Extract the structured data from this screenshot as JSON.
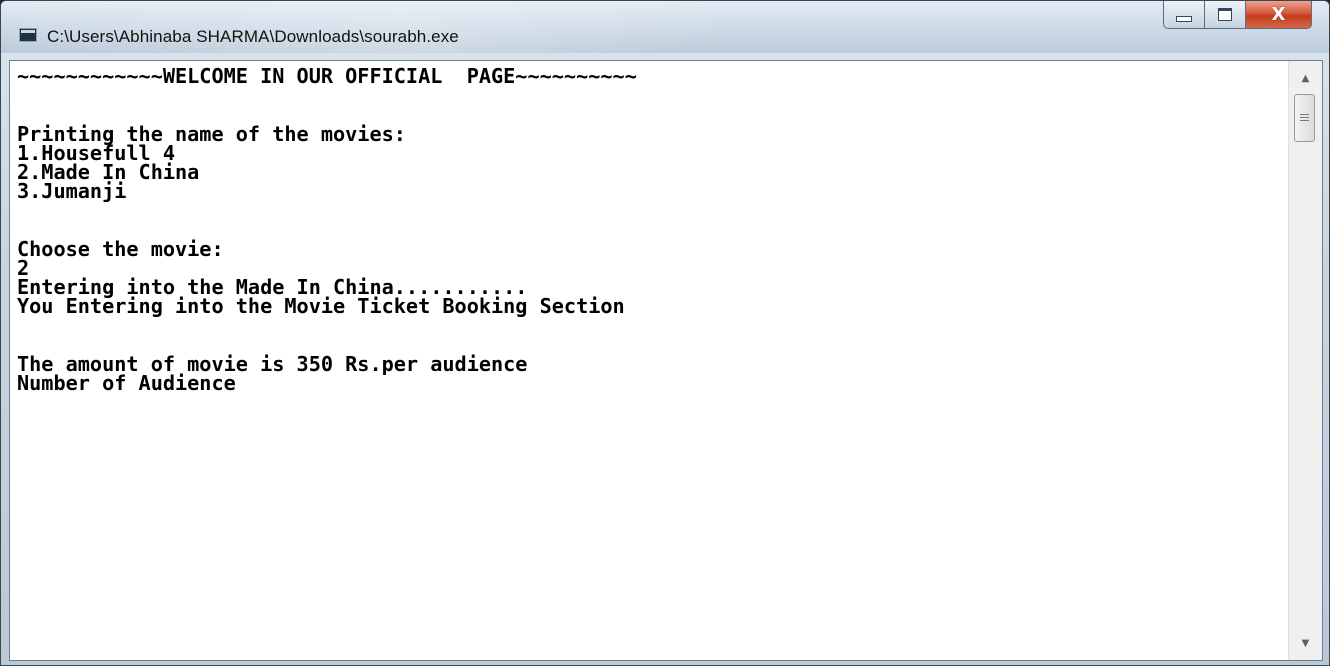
{
  "window": {
    "title": "C:\\Users\\Abhinaba SHARMA\\Downloads\\sourabh.exe",
    "icon": "console-app-icon",
    "buttons": {
      "minimize_icon": "minimize-icon",
      "maximize_icon": "maximize-icon",
      "close_label": "X"
    }
  },
  "console": {
    "lines": [
      "~~~~~~~~~~~~WELCOME IN OUR OFFICIAL  PAGE~~~~~~~~~~",
      "",
      "",
      "Printing the name of the movies:",
      "1.Housefull 4",
      "2.Made In China",
      "3.Jumanji",
      "",
      "",
      "Choose the movie:",
      "2",
      "Entering into the Made In China...........",
      "You Entering into the Movie Ticket Booking Section",
      "",
      "",
      "The amount of movie is 350 Rs.per audience",
      "Number of Audience"
    ]
  },
  "scrollbar": {
    "up_arrow": "▲",
    "down_arrow": "▼"
  },
  "colors": {
    "console_bg": "#ffffff",
    "console_fg": "#000000",
    "close_button": "#c33b1c"
  }
}
